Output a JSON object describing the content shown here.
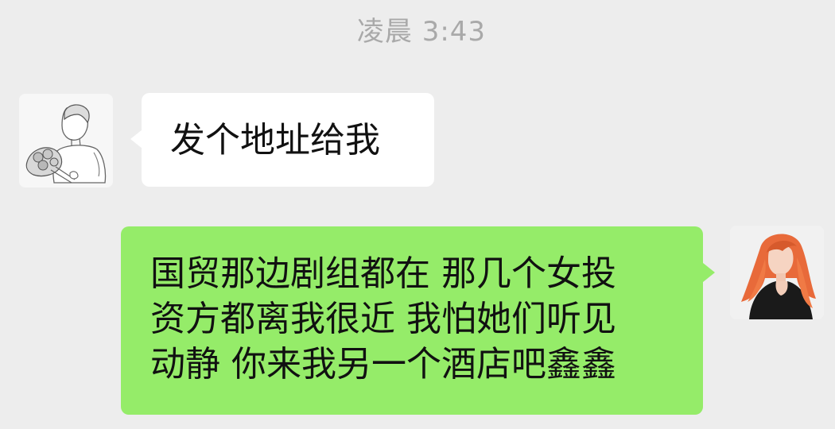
{
  "timestamp": "凌晨 3:43",
  "messages": [
    {
      "side": "left",
      "avatar_icon": "sketch-boy-with-flowers-avatar",
      "text": "发个地址给我"
    },
    {
      "side": "right",
      "avatar_icon": "red-haired-woman-avatar",
      "lines": [
        "国贸那边剧组都在 那几个女投",
        "资方都离我很近 我怕她们听见",
        "动静 你来我另一个酒店吧鑫鑫"
      ]
    }
  ],
  "colors": {
    "background": "#ededed",
    "incoming_bubble": "#ffffff",
    "outgoing_bubble": "#95ec69",
    "timestamp_text": "#a9a9a9"
  }
}
